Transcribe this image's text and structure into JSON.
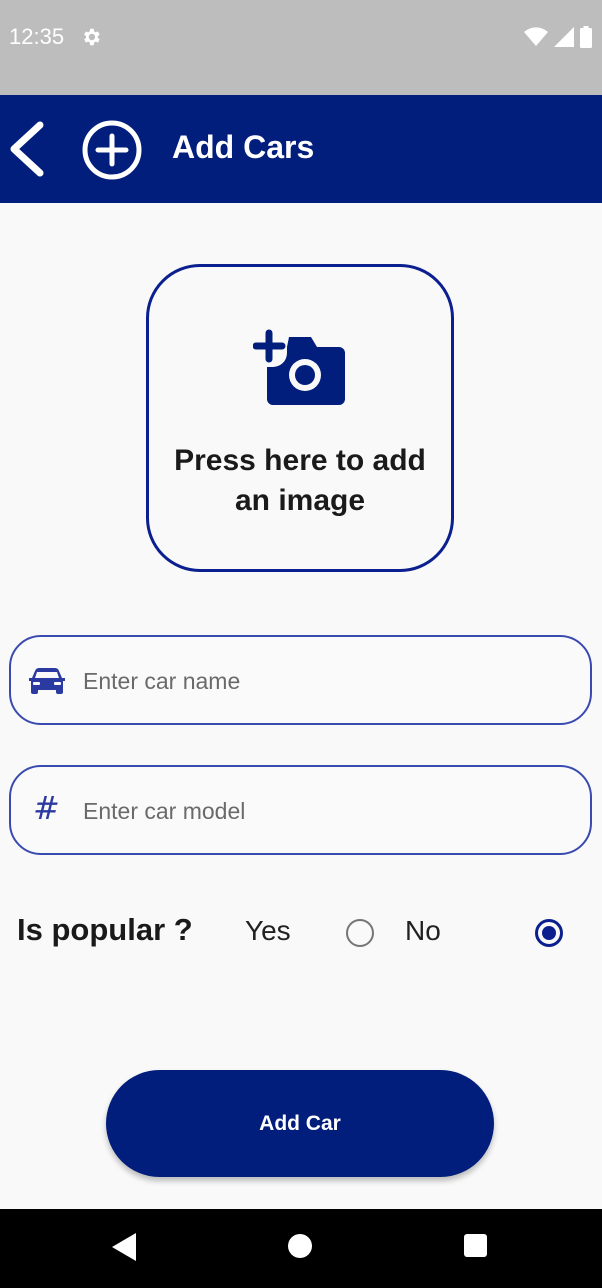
{
  "status_bar": {
    "time": "12:35",
    "icons": [
      "gear-icon",
      "wifi-icon",
      "signal-icon",
      "battery-icon"
    ]
  },
  "app_bar": {
    "title": "Add Cars",
    "back_icon": "chevron-left-icon",
    "title_icon": "add-circle-icon",
    "color": "#021e7c"
  },
  "image_picker": {
    "icon": "add-photo-camera-icon",
    "text": "Press here to add an image"
  },
  "form": {
    "car_name": {
      "icon": "car-icon",
      "value": "",
      "placeholder": "Enter car name"
    },
    "car_model": {
      "icon": "hash-icon",
      "symbol": "#",
      "value": "",
      "placeholder": "Enter car model"
    }
  },
  "popular": {
    "label": "Is popular ?",
    "options": [
      {
        "label": "Yes",
        "selected": false
      },
      {
        "label": "No",
        "selected": true
      }
    ]
  },
  "submit": {
    "label": "Add Car"
  },
  "nav_bar": {
    "icons": [
      "nav-back-icon",
      "nav-home-icon",
      "nav-recents-icon"
    ]
  }
}
